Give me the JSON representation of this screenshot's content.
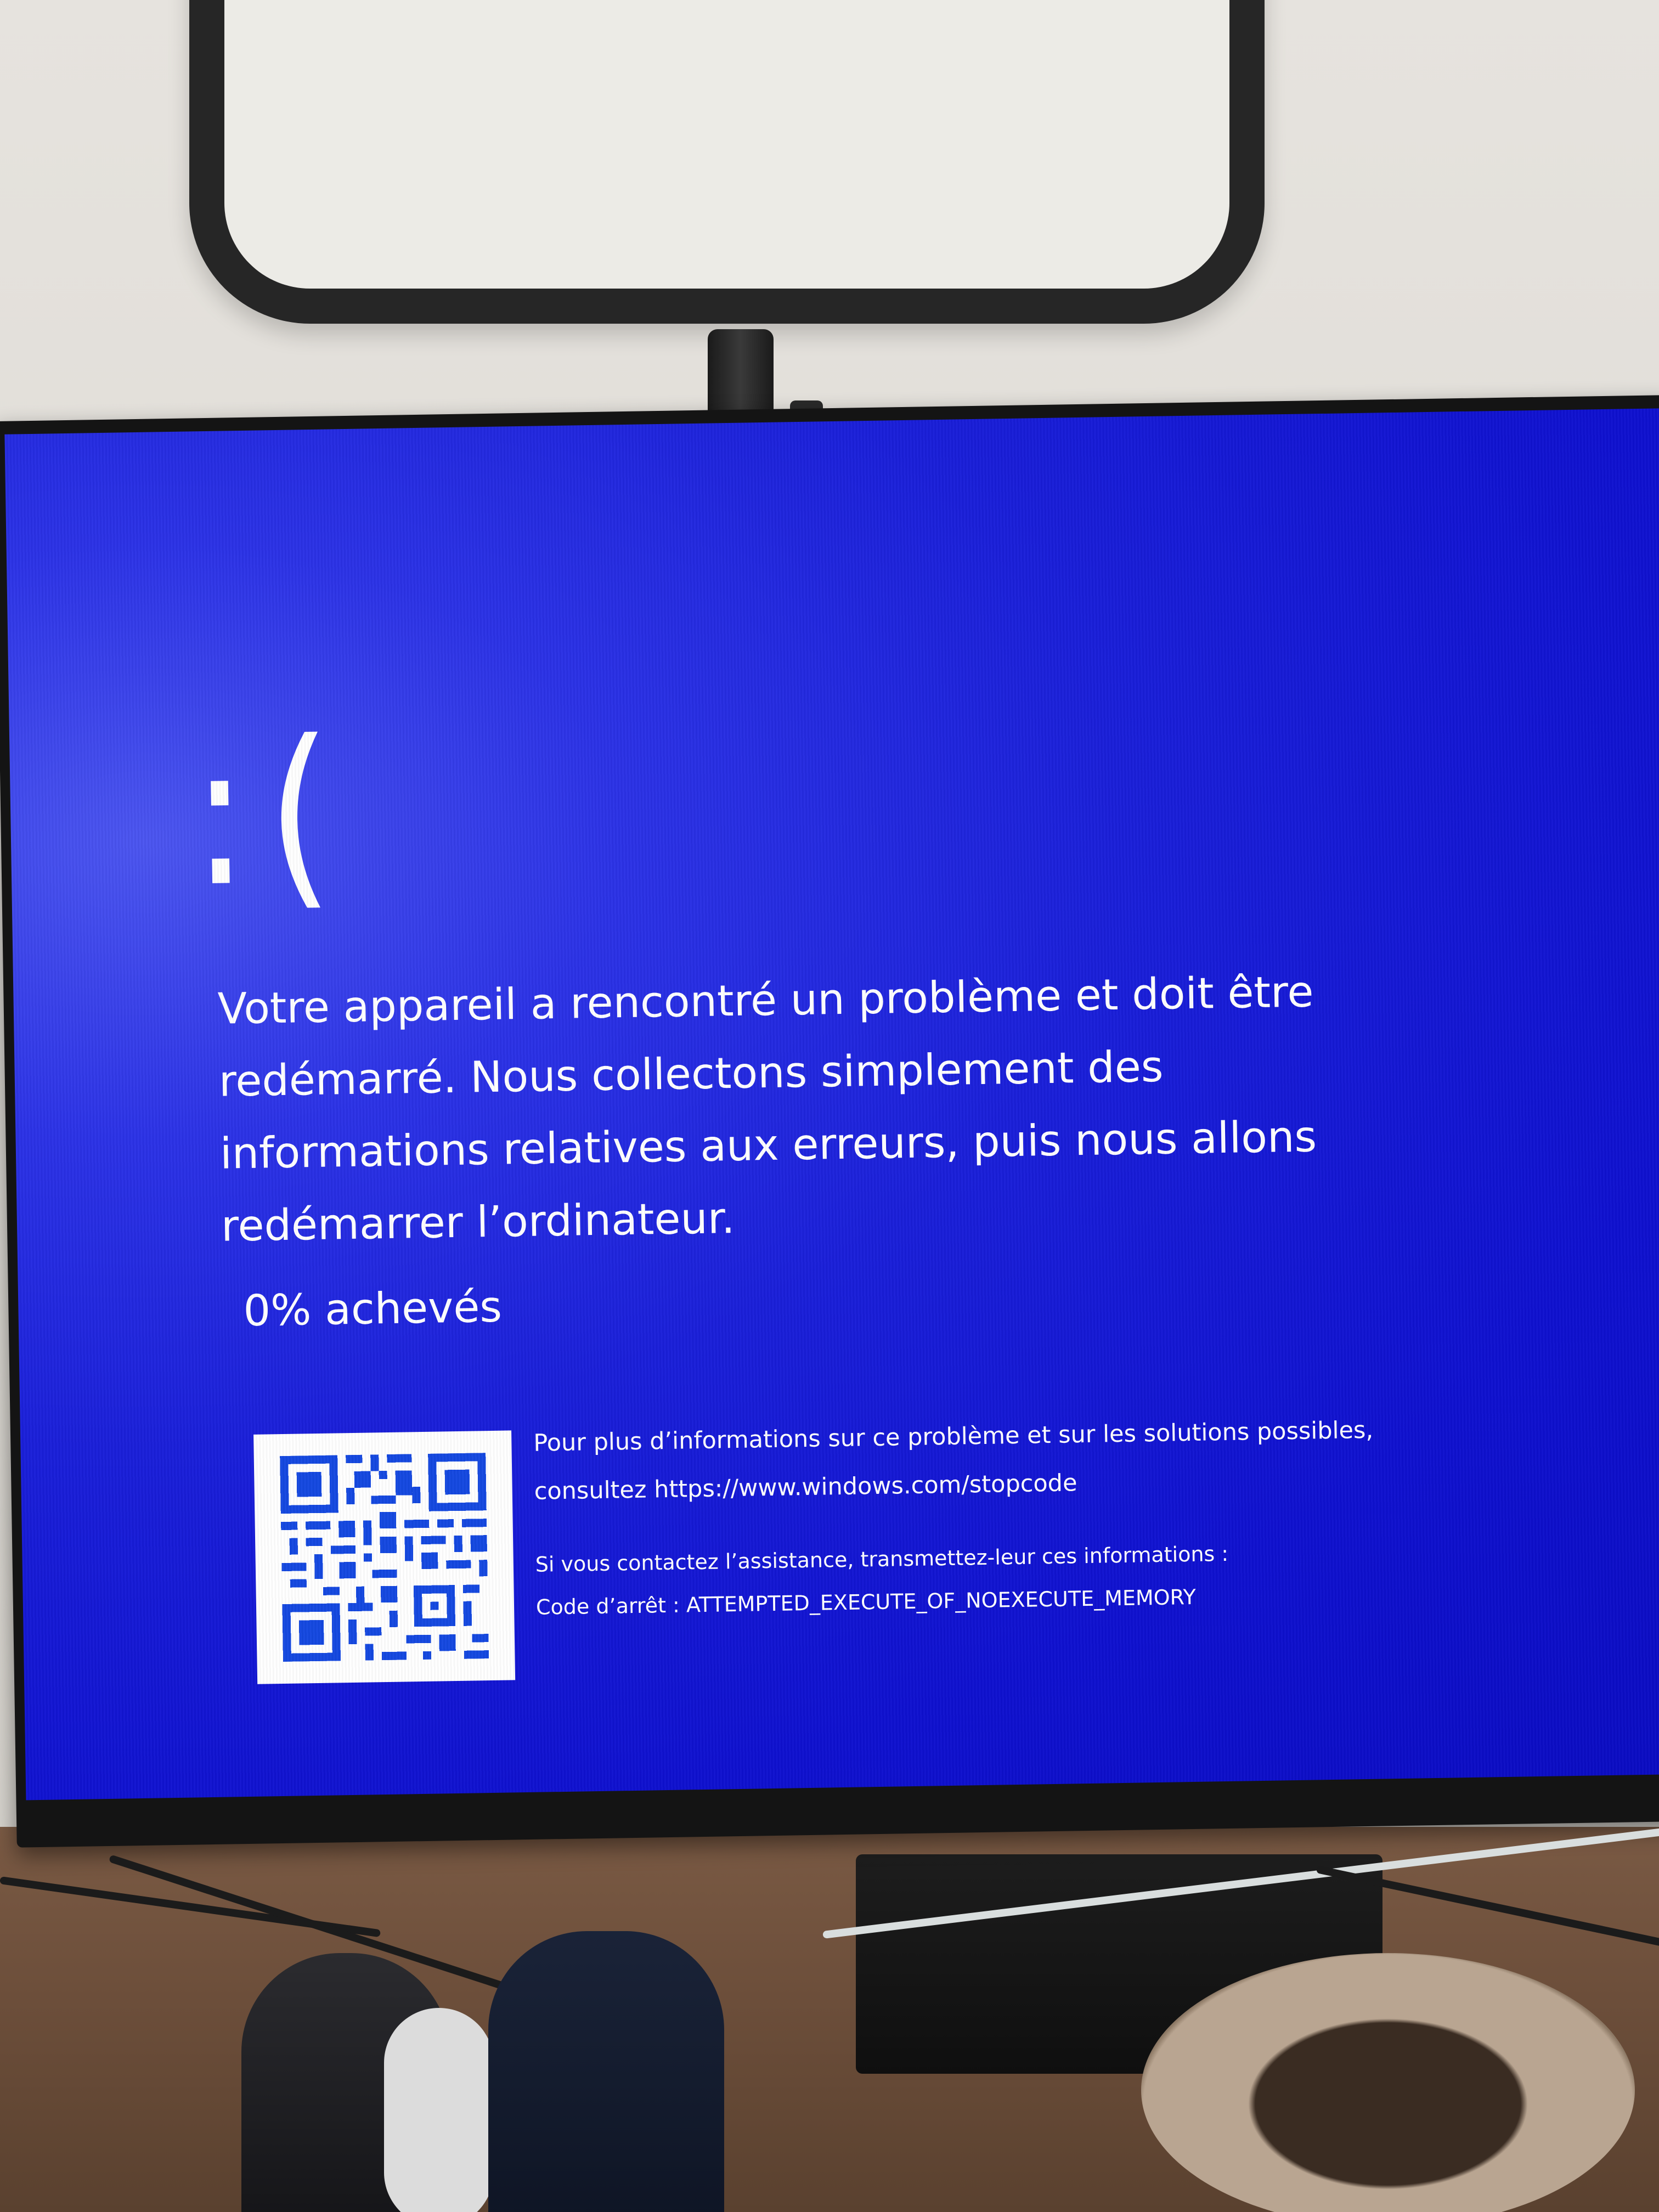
{
  "bsod": {
    "sad_face": ":(",
    "main_message": "Votre appareil a rencontré un problème et doit être redémarré. Nous collectons simplement des informations relatives aux erreurs, puis nous allons redémarrer l’ordinateur.",
    "progress_text": "0% achevés",
    "progress_percent": 0,
    "more_info": "Pour plus d’informations sur ce problème et sur les solutions possibles, consultez https://www.windows.com/stopcode",
    "contact_text": "Si vous contactez l’assistance, transmettez-leur ces informations :",
    "stop_code_line": "Code d’arrêt : ATTEMPTED_EXECUTE_OF_NOEXECUTE_MEMORY"
  },
  "colors": {
    "screen_blue": "#1a1fd9",
    "qr_blue": "#1448e0",
    "text": "#ffffff"
  },
  "icons": {
    "qr_code": "qr-code-icon"
  }
}
